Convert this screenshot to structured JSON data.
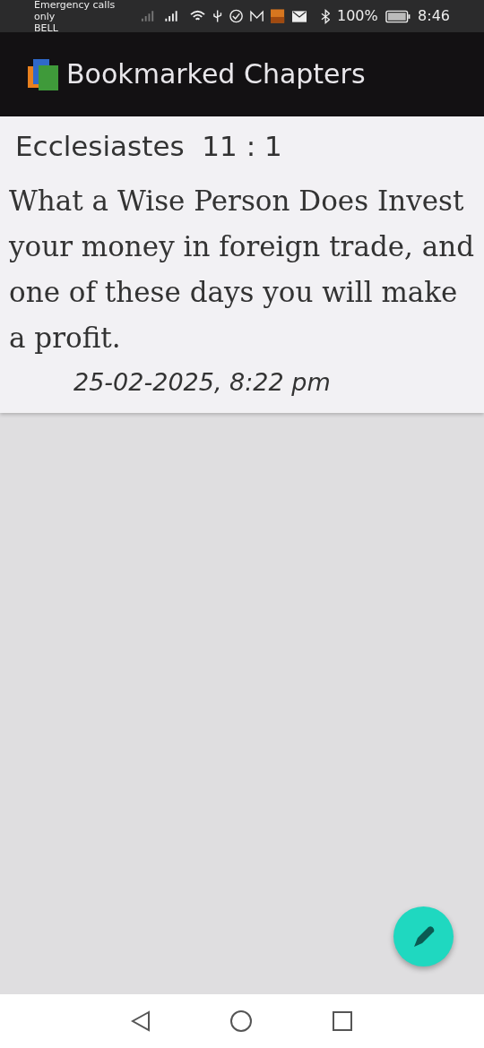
{
  "status_bar": {
    "carrier_line": "Emergency calls only",
    "carrier": "BELL",
    "battery": "100%",
    "time": "8:46"
  },
  "app_bar": {
    "title": "Bookmarked Chapters"
  },
  "bookmarks": [
    {
      "reference": "Ecclesiastes  11 : 1",
      "text": "What a Wise Person Does Invest your money in foreign trade, and one of these days you will make a profit.",
      "date": "25-02-2025, 8:22 pm"
    }
  ]
}
